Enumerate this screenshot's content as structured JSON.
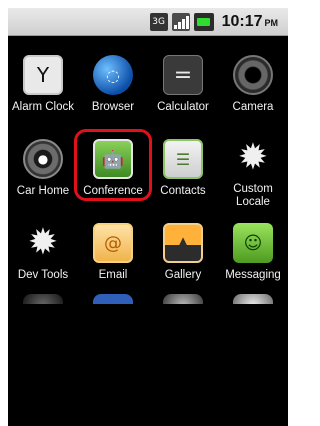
{
  "status_bar": {
    "network_label": "3G",
    "time": "10:17",
    "ampm": "PM",
    "icons": [
      "3g-icon",
      "signal-icon",
      "battery-icon"
    ]
  },
  "apps": [
    {
      "label": "Alarm Clock",
      "icon": "alarm-clock-icon",
      "color": "#e9e9e9"
    },
    {
      "label": "Browser",
      "icon": "browser-globe-icon",
      "color": "#2e6fd0"
    },
    {
      "label": "Calculator",
      "icon": "calculator-icon",
      "color": "#3a3a3a"
    },
    {
      "label": "Camera",
      "icon": "camera-icon",
      "color": "#2b2b2b"
    },
    {
      "label": "Car Home",
      "icon": "car-home-icon",
      "color": "#444"
    },
    {
      "label": "Conference",
      "icon": "conference-android-icon",
      "color": "#5aa13a"
    },
    {
      "label": "Contacts",
      "icon": "contacts-icon",
      "color": "#dcdcdc"
    },
    {
      "label": "Custom\nLocale",
      "icon": "custom-locale-gear-icon",
      "color": "#ff8a2a"
    },
    {
      "label": "Dev Tools",
      "icon": "dev-tools-gear-icon",
      "color": "#ff8a2a"
    },
    {
      "label": "Email",
      "icon": "email-icon",
      "color": "#f2c26a"
    },
    {
      "label": "Gallery",
      "icon": "gallery-icon",
      "color": "#f3b23a"
    },
    {
      "label": "Messaging",
      "icon": "messaging-icon",
      "color": "#7bc544"
    }
  ],
  "colors": {
    "highlight": "#e0111b"
  }
}
